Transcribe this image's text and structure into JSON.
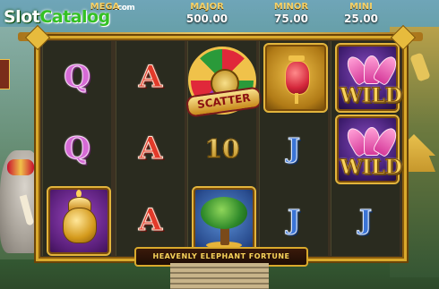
{
  "logo": {
    "part1": "Slot",
    "part2": "Catalog",
    "suffix": ".com"
  },
  "jackpots": [
    {
      "name": "MEGA",
      "value": ""
    },
    {
      "name": "MAJOR",
      "value": "500.00"
    },
    {
      "name": "MINOR",
      "value": "75.00"
    },
    {
      "name": "MINI",
      "value": "25.00"
    }
  ],
  "reels": [
    [
      "Q",
      "Q",
      "pot"
    ],
    [
      "A",
      "A",
      "A"
    ],
    [
      "scatter",
      "10",
      "tree"
    ],
    [
      "lantern",
      "J",
      "J"
    ],
    [
      "wild",
      "wild",
      "J"
    ]
  ],
  "symbols": {
    "scatter_label": "SCATTER",
    "wild_label": "WILD",
    "ten_label": "10"
  },
  "game_title": "HEAVENLY ELEPHANT FORTUNE",
  "colors": {
    "frame_gold": "#d9a92c",
    "logo_green": "#34c124"
  }
}
